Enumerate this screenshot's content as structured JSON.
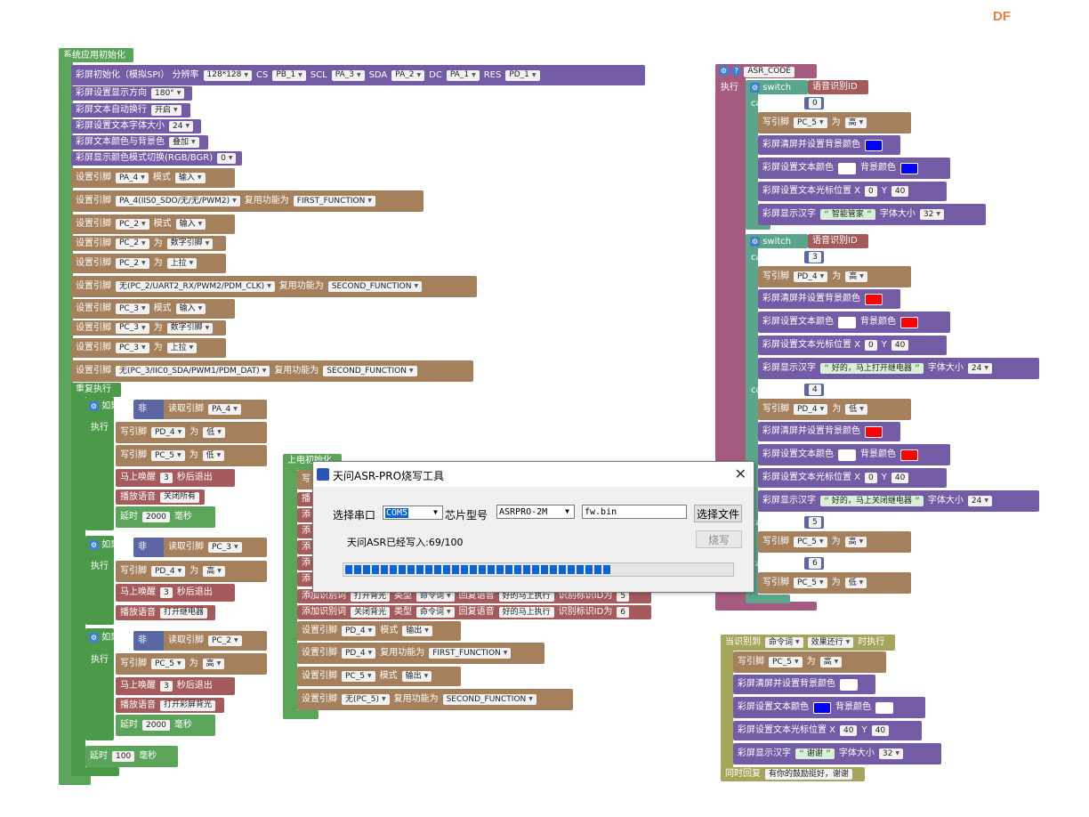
{
  "watermark": "DF",
  "init": {
    "title": "系统应用初始化",
    "rows": [
      [
        "彩屏初始化（模拟SPI） 分辨率",
        "128*128",
        "CS",
        "PB_1",
        "SCL",
        "PA_3",
        "SDA",
        "PA_2",
        "DC",
        "PA_1",
        "RES",
        "PD_1"
      ],
      [
        "彩屏设置显示方向",
        "180°"
      ],
      [
        "彩屏文本自动换行",
        "开启"
      ],
      [
        "彩屏设置文本字体大小",
        "24"
      ],
      [
        "彩屏文本颜色与背景色",
        "叠加"
      ],
      [
        "彩屏显示颜色模式切换(RGB/BGR)",
        "0"
      ],
      [
        "设置引脚",
        "PA_4",
        "模式",
        "输入"
      ],
      [
        "设置引脚",
        "PA_4(IIS0_SDO/无/无/PWM2)",
        "复用功能为",
        "FIRST_FUNCTION"
      ],
      [
        "设置引脚",
        "PC_2",
        "模式",
        "输入"
      ],
      [
        "设置引脚",
        "PC_2",
        "为",
        "数字引脚"
      ],
      [
        "设置引脚",
        "PC_2",
        "为",
        "上拉"
      ],
      [
        "设置引脚",
        "无(PC_2/UART2_RX/PWM2/PDM_CLK)",
        "复用功能为",
        "SECOND_FUNCTION"
      ],
      [
        "设置引脚",
        "PC_3",
        "模式",
        "输入"
      ],
      [
        "设置引脚",
        "PC_3",
        "为",
        "数字引脚"
      ],
      [
        "设置引脚",
        "PC_3",
        "为",
        "上拉"
      ],
      [
        "设置引脚",
        "无(PC_3/IIC0_SDA/PWM1/PDM_DAT)",
        "复用功能为",
        "SECOND_FUNCTION"
      ]
    ],
    "loop_label": "重复执行",
    "if_label": "如果",
    "not_label": "非",
    "exec_label": "执行",
    "read_pin_label": "读取引脚",
    "write_pin_label": "写引脚",
    "wei": "为",
    "if1": {
      "pin": "PA_4",
      "w1_pin": "PD_4",
      "w1_val": "低",
      "w2_pin": "PC_5",
      "w2_val": "低",
      "sleep_pre": "马上唤醒",
      "sleep_val": "3",
      "sleep_post": "秒后退出",
      "play_pre": "播放语音",
      "play_val": "关闭所有",
      "delay_pre": "延时",
      "delay_val": "2000",
      "delay_post": "毫秒"
    },
    "if2": {
      "pin": "PC_3",
      "w1_pin": "PD_4",
      "w1_val": "高",
      "sleep_pre": "马上唤醒",
      "sleep_val": "3",
      "sleep_post": "秒后退出",
      "play_pre": "播放语音",
      "play_val": "打开继电器"
    },
    "if3": {
      "pin": "PC_2",
      "w1_pin": "PC_5",
      "w1_val": "高",
      "sleep_pre": "马上唤醒",
      "sleep_val": "3",
      "sleep_post": "秒后退出",
      "play_pre": "播放语音",
      "play_val": "打开彩屏背光",
      "delay_pre": "延时",
      "delay_val": "2000",
      "delay_post": "毫秒"
    },
    "final_delay": {
      "pre": "延时",
      "val": "100",
      "post": "毫秒"
    }
  },
  "power": {
    "title": "上电初始化",
    "partial_rows": [
      "写",
      "播",
      "添",
      "添",
      "添",
      "添",
      "添",
      "添"
    ],
    "add_rows": [
      {
        "pre": "添加识别词",
        "word": "打开背光",
        "type_lbl": "类型",
        "type": "命令词",
        "reply_lbl": "回复语音",
        "reply": "好的马上执行",
        "id_lbl": "识别标识ID为",
        "id": "5"
      },
      {
        "pre": "添加识别词",
        "word": "关闭背光",
        "type_lbl": "类型",
        "type": "命令词",
        "reply_lbl": "回复语音",
        "reply": "好的马上执行",
        "id_lbl": "识别标识ID为",
        "id": "6"
      }
    ],
    "pin_rows": [
      [
        "设置引脚",
        "PD_4",
        "模式",
        "输出"
      ],
      [
        "设置引脚",
        "PD_4",
        "复用功能为",
        "FIRST_FUNCTION"
      ],
      [
        "设置引脚",
        "PC_5",
        "模式",
        "输出"
      ],
      [
        "设置引脚",
        "无(PC_5)",
        "复用功能为",
        "SECOND_FUNCTION"
      ]
    ]
  },
  "asr": {
    "title": "ASR_CODE",
    "exec": "执行",
    "switch": "switch",
    "var": "语音识别ID",
    "case": "case",
    "wei": "为",
    "clear": "彩屏清屏并设置背景颜色",
    "textcolor": "彩屏设置文本颜色",
    "bgcolor": "背景颜色",
    "cursor": "彩屏设置文本光标位置 X",
    "y": "Y",
    "show": "彩屏显示汉字",
    "fontsize": "字体大小",
    "write": "写引脚",
    "case0": {
      "val": "0",
      "pin": "PC_5",
      "level": "高",
      "x": "0",
      "yv": "40",
      "text": "智能管家",
      "size": "32"
    },
    "case3": {
      "val": "3",
      "pin": "PD_4",
      "level": "高",
      "x": "0",
      "yv": "40",
      "text": "好的，马上打开继电器",
      "size": "24"
    },
    "case4": {
      "val": "4",
      "pin": "PD_4",
      "level": "低",
      "x": "0",
      "yv": "40",
      "text": "好的，马上关闭继电器",
      "size": "24"
    },
    "case5": {
      "val": "5",
      "pin": "PC_5",
      "level": "高"
    },
    "case6": {
      "val": "6",
      "pin": "PC_5",
      "level": "低"
    }
  },
  "recog": {
    "pre": "当识别到",
    "type": "命令词",
    "effect": "效果还行",
    "post": "时执行",
    "write": "写引脚",
    "pin": "PC_5",
    "wei": "为",
    "level": "高",
    "clear": "彩屏清屏并设置背景颜色",
    "textcolor": "彩屏设置文本颜色",
    "bgcolor": "背景颜色",
    "cursor": "彩屏设置文本光标位置 X",
    "x": "40",
    "y": "Y",
    "yv": "40",
    "show": "彩屏显示汉字",
    "text": "谢谢",
    "fontsize": "字体大小",
    "size": "32",
    "reply_pre": "同时回复",
    "reply": "有你的鼓励挺好，谢谢"
  },
  "dialog": {
    "title": "天问ASR-PRO烧写工具",
    "port_label": "选择串口",
    "port_value": "COM5",
    "chip_label": "芯片型号",
    "chip_value": "ASRPRO-2M",
    "file_value": "fw.bin",
    "choose_file": "选择文件",
    "burn": "烧写",
    "status": "天问ASR已经写入:69/100",
    "progress": 0.69
  },
  "colors": {
    "blue": "#0000ff",
    "red": "#ff0000",
    "white": "#ffffff",
    "accent": "#e9803b"
  }
}
